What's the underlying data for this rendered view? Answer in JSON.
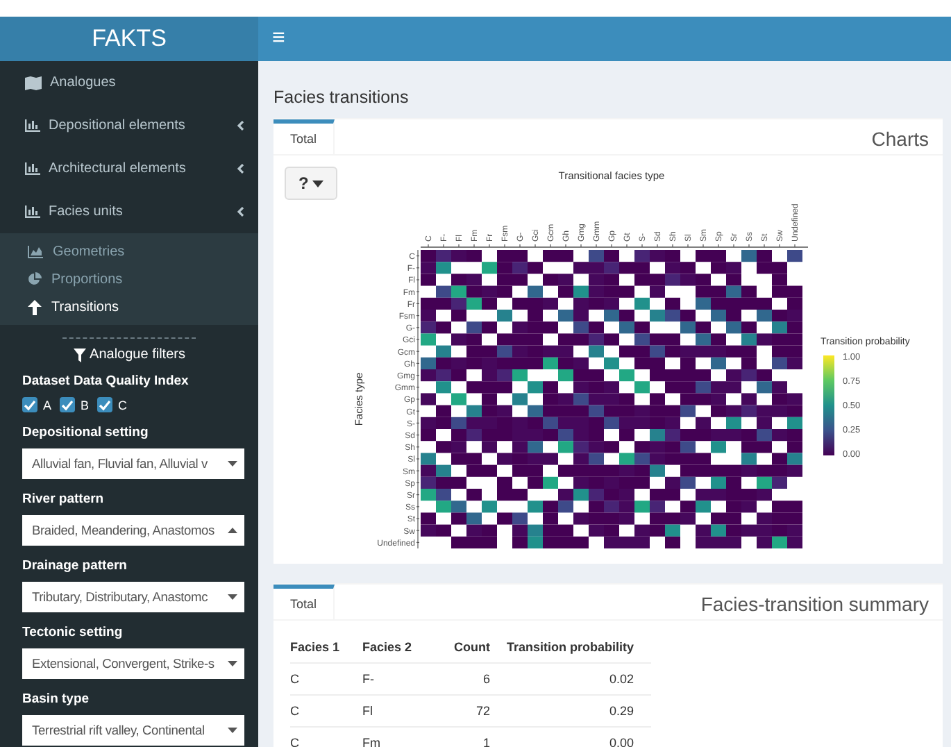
{
  "header": {
    "logo": "FAKTS",
    "menu_icon": "≡"
  },
  "sidebar": {
    "items": [
      {
        "label": "Analogues",
        "has_submenu": false
      },
      {
        "label": "Depositional elements",
        "has_submenu": true
      },
      {
        "label": "Architectural elements",
        "has_submenu": true
      },
      {
        "label": "Facies units",
        "has_submenu": true,
        "children": [
          {
            "label": "Geometries",
            "selected": false
          },
          {
            "label": "Proportions",
            "selected": false
          },
          {
            "label": "Transitions",
            "selected": true
          }
        ]
      }
    ],
    "filters": {
      "title": "Analogue filters",
      "quality": {
        "label": "Dataset Data Quality Index",
        "options": [
          {
            "label": "A",
            "checked": true
          },
          {
            "label": "B",
            "checked": true
          },
          {
            "label": "C",
            "checked": true
          }
        ]
      },
      "selects": [
        {
          "label": "Depositional setting",
          "value": "Alluvial fan, Fluvial fan, Alluvial v",
          "open": false
        },
        {
          "label": "River pattern",
          "value": "Braided, Meandering, Anastomos",
          "open": true
        },
        {
          "label": "Drainage pattern",
          "value": "Tributary, Distributary, Anastomc",
          "open": false
        },
        {
          "label": "Tectonic setting",
          "value": "Extensional, Convergent, Strike-s",
          "open": false
        },
        {
          "label": "Basin type",
          "value": "Terrestrial rift valley, Continental",
          "open": false
        }
      ]
    }
  },
  "page_title": "Facies transitions",
  "charts_box": {
    "tab": "Total",
    "title": "Charts",
    "help_button": "?",
    "heatmap": {
      "title": "Transitional facies type",
      "ylabel": "Facies type",
      "columns": [
        "C",
        "F-",
        "Fl",
        "Fm",
        "Fr",
        "Fsm",
        "G-",
        "Gci",
        "Gcm",
        "Gh",
        "Gmg",
        "Gmm",
        "Gp",
        "Gt",
        "S-",
        "Sd",
        "Sh",
        "Sl",
        "Sm",
        "Sp",
        "Sr",
        "Ss",
        "St",
        "Sw",
        "Undefined"
      ],
      "rows": [
        "C",
        "F-",
        "Fl",
        "Fm",
        "Fr",
        "Fsm",
        "G-",
        "Gci",
        "Gcm",
        "Gh",
        "Gmg",
        "Gmm",
        "Gp",
        "Gt",
        "S-",
        "Sd",
        "Sh",
        "Sl",
        "Sm",
        "Sp",
        "Sr",
        "Ss",
        "St",
        "Sw",
        "Undefined"
      ],
      "legend": {
        "title": "Transition probability",
        "ticks": [
          "1.00",
          "0.75",
          "0.50",
          "0.25",
          "0.00"
        ]
      }
    }
  },
  "summary_box": {
    "tab": "Total",
    "title": "Facies-transition summary",
    "columns": [
      "Facies 1",
      "Facies 2",
      "Count",
      "Transition probability"
    ],
    "rows": [
      [
        "C",
        "F-",
        "6",
        "0.02"
      ],
      [
        "C",
        "Fl",
        "72",
        "0.29"
      ],
      [
        "C",
        "Fm",
        "1",
        "0.00"
      ]
    ]
  }
}
